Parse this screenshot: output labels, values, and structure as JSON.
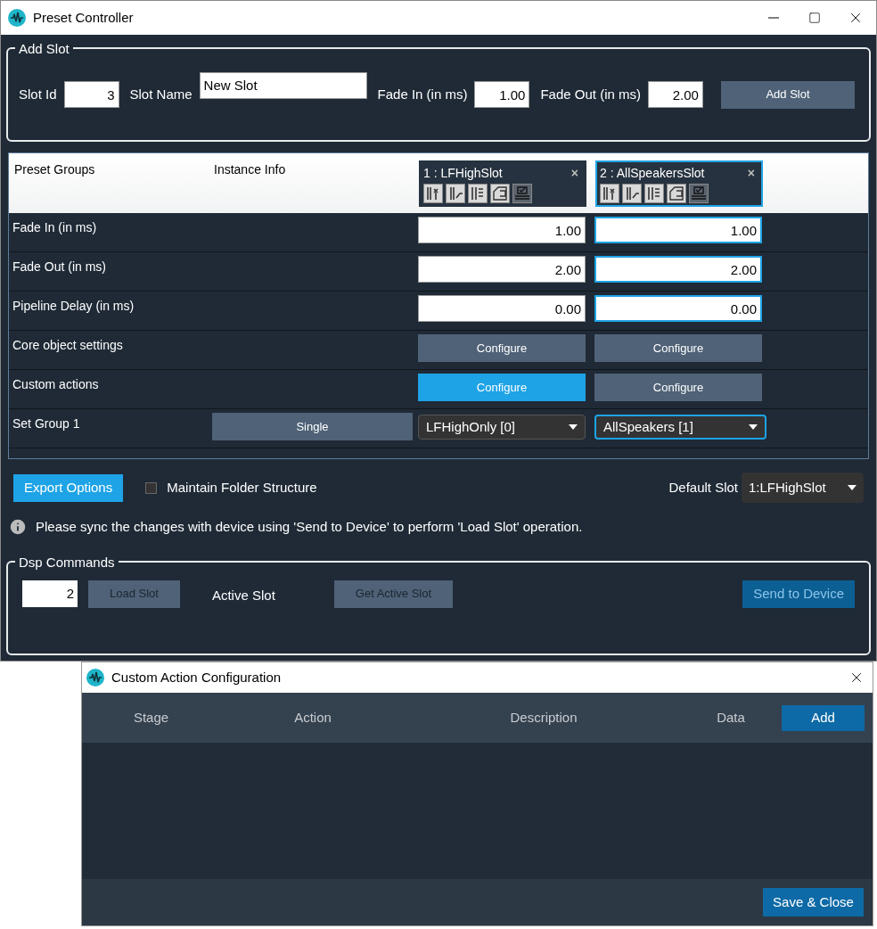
{
  "window": {
    "title": "Preset Controller"
  },
  "add_slot": {
    "legend": "Add Slot",
    "fields": [
      {
        "kind": "number",
        "label": "Slot Id",
        "value": "3"
      },
      {
        "kind": "text",
        "label": "Slot Name",
        "value": "New Slot"
      },
      {
        "kind": "number",
        "label": "Fade In (in ms)",
        "value": "1.00"
      },
      {
        "kind": "number",
        "label": "Fade Out (in ms)",
        "value": "2.00"
      }
    ],
    "button": "Add Slot"
  },
  "table": {
    "headers": [
      "Preset Groups",
      "Instance Info"
    ],
    "slots": [
      {
        "title": "1 : LFHighSlot",
        "close": "×",
        "selected": false
      },
      {
        "title": "2 : AllSpeakersSlot",
        "close": "×",
        "selected": true
      }
    ],
    "rows": [
      {
        "kind": "field",
        "label": "Fade In (in ms)",
        "values": [
          "1.00",
          "1.00"
        ]
      },
      {
        "kind": "field",
        "label": "Fade Out (in ms)",
        "values": [
          "2.00",
          "2.00"
        ]
      },
      {
        "kind": "field",
        "label": "Pipeline Delay (in ms)",
        "values": [
          "0.00",
          "0.00"
        ]
      },
      {
        "kind": "button",
        "label": "Core object settings",
        "buttons": [
          {
            "label": "Configure",
            "highlighted": false
          },
          {
            "label": "Configure",
            "highlighted": false
          }
        ]
      },
      {
        "kind": "button",
        "label": "Custom actions",
        "buttons": [
          {
            "label": "Configure",
            "highlighted": true
          },
          {
            "label": "Configure",
            "highlighted": false
          }
        ]
      },
      {
        "kind": "select",
        "label": "Set Group 1",
        "instance": "Single",
        "values": [
          "LFHighOnly [0]",
          "AllSpeakers [1]"
        ]
      }
    ]
  },
  "export": {
    "button": "Export Options",
    "checkbox": {
      "label": "Maintain Folder Structure",
      "checked": false
    },
    "default_slot_label": "Default Slot",
    "default_slot": "1:LFHighSlot"
  },
  "info": "Please sync the changes with device using 'Send to Device' to perform 'Load Slot' operation.",
  "dsp": {
    "legend": "Dsp Commands",
    "items": [
      {
        "kind": "input",
        "value": "2"
      },
      {
        "kind": "button",
        "label": "Load Slot",
        "disabled": true
      },
      {
        "kind": "label",
        "label": "Active Slot"
      },
      {
        "kind": "button",
        "label": "Get Active Slot",
        "disabled": true
      }
    ],
    "send": {
      "label": "Send to Device",
      "disabled": true
    }
  },
  "dialog": {
    "title": "Custom Action Configuration",
    "columns": [
      "Stage",
      "Action",
      "Description",
      "Data"
    ],
    "add": "Add",
    "save": "Save & Close"
  }
}
